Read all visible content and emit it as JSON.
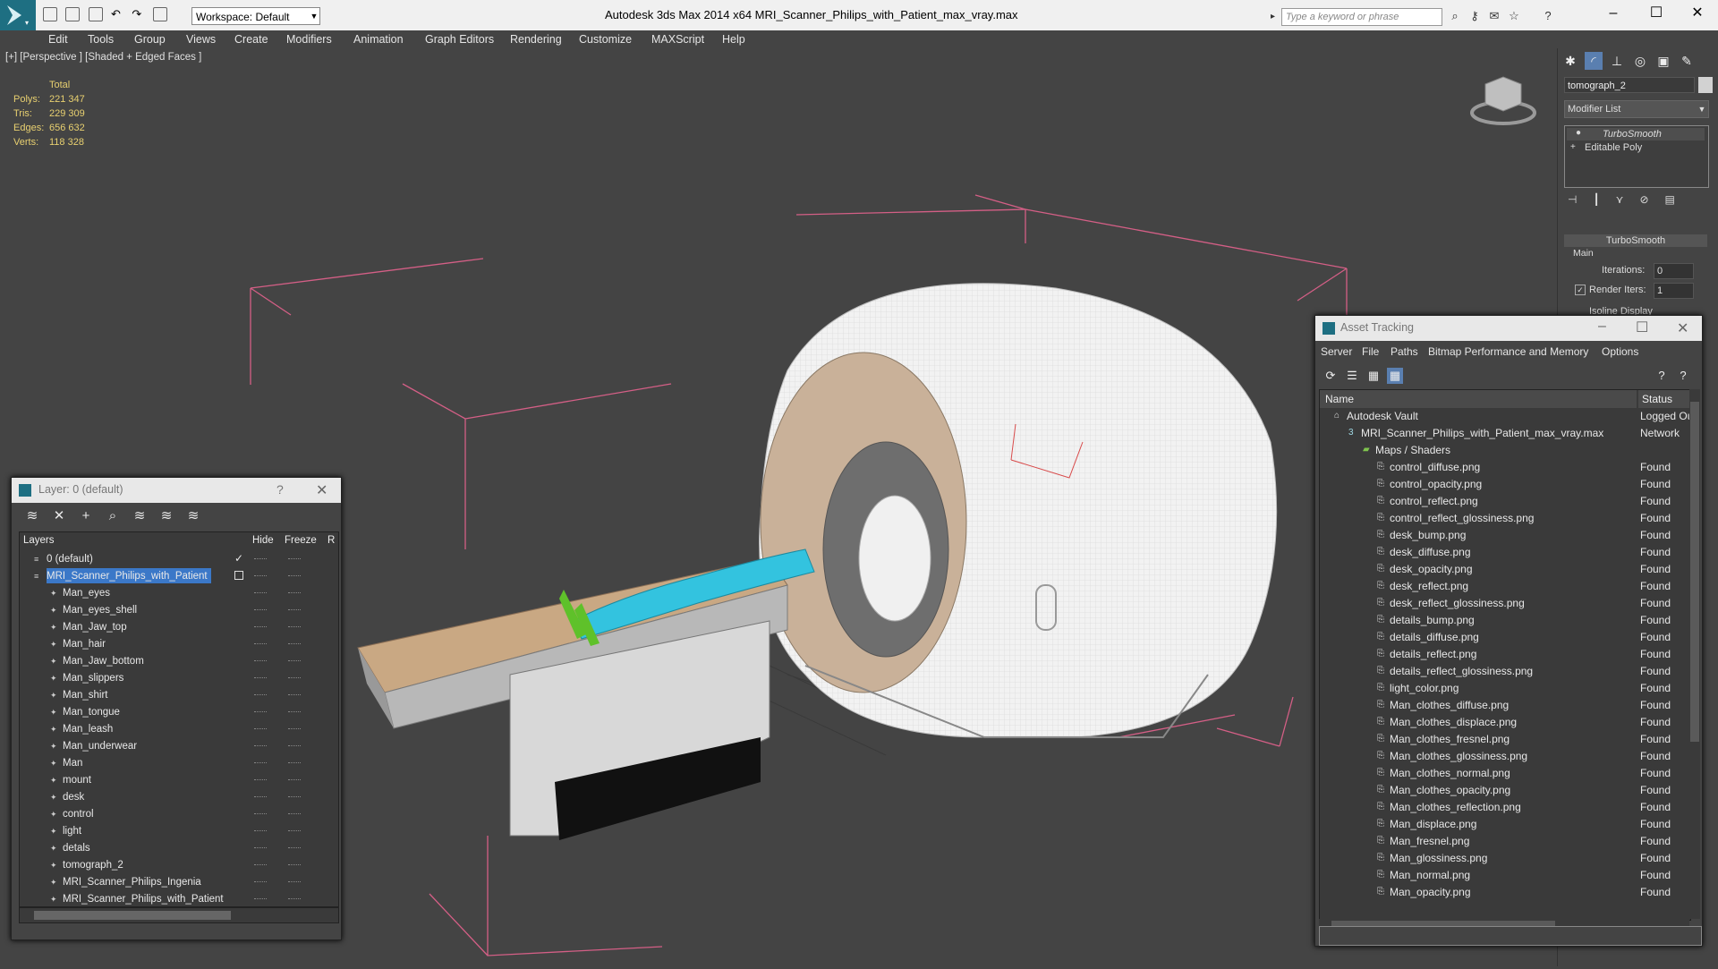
{
  "window": {
    "title": "Autodesk 3ds Max  2014 x64       MRI_Scanner_Philips_with_Patient_max_vray.max",
    "workspace": "Workspace: Default",
    "search_placeholder": "Type a keyword or phrase"
  },
  "menu": [
    "Edit",
    "Tools",
    "Group",
    "Views",
    "Create",
    "Modifiers",
    "Animation",
    "Graph Editors",
    "Rendering",
    "Customize",
    "MAXScript",
    "Help"
  ],
  "viewport": {
    "label": "[+] [Perspective ] [Shaded + Edged Faces ]",
    "stats_header": "Total",
    "stats": [
      {
        "label": "Polys:",
        "value": "221 347"
      },
      {
        "label": "Tris:",
        "value": "229 309"
      },
      {
        "label": "Edges:",
        "value": "656 632"
      },
      {
        "label": "Verts:",
        "value": "118 328"
      }
    ],
    "colors": {
      "box": "#d45f86",
      "wire": "#ffffff",
      "scanner": "#f4f4f4",
      "patient": "#33c3df",
      "slippers": "#5fc12a",
      "bore": "#b9a084"
    }
  },
  "command_panel": {
    "object_name": "tomograph_2",
    "modifier_list": "Modifier List",
    "stack": [
      "TurboSmooth",
      "Editable Poly"
    ],
    "rollout_title": "TurboSmooth",
    "group": "Main",
    "iterations_label": "Iterations:",
    "iterations_value": "0",
    "render_iters_label": "Render Iters:",
    "render_iters_value": "1",
    "isoline_label": "Isoline Display"
  },
  "layer_dialog": {
    "title": "Layer: 0 (default)",
    "help": "?",
    "columns": [
      "Layers",
      "Hide",
      "Freeze",
      "R"
    ],
    "rows": [
      {
        "name": "0 (default)",
        "level": 0,
        "checked": true
      },
      {
        "name": "MRI_Scanner_Philips_with_Patient",
        "level": 0,
        "selected": true
      },
      {
        "name": "Man_eyes",
        "level": 1
      },
      {
        "name": "Man_eyes_shell",
        "level": 1
      },
      {
        "name": "Man_Jaw_top",
        "level": 1
      },
      {
        "name": "Man_hair",
        "level": 1
      },
      {
        "name": "Man_Jaw_bottom",
        "level": 1
      },
      {
        "name": "Man_slippers",
        "level": 1
      },
      {
        "name": "Man_shirt",
        "level": 1
      },
      {
        "name": "Man_tongue",
        "level": 1
      },
      {
        "name": "Man_leash",
        "level": 1
      },
      {
        "name": "Man_underwear",
        "level": 1
      },
      {
        "name": "Man",
        "level": 1
      },
      {
        "name": "mount",
        "level": 1
      },
      {
        "name": "desk",
        "level": 1
      },
      {
        "name": "control",
        "level": 1
      },
      {
        "name": "light",
        "level": 1
      },
      {
        "name": "detals",
        "level": 1
      },
      {
        "name": "tomograph_2",
        "level": 1
      },
      {
        "name": "MRI_Scanner_Philips_Ingenia",
        "level": 1
      },
      {
        "name": "MRI_Scanner_Philips_with_Patient",
        "level": 1
      }
    ]
  },
  "asset_tracking": {
    "title": "Asset Tracking",
    "menu": [
      "Server",
      "File",
      "Paths",
      "Bitmap Performance and Memory",
      "Options"
    ],
    "columns": [
      "Name",
      "Status"
    ],
    "rows": [
      {
        "name": "Autodesk Vault",
        "status": "Logged Out",
        "level": 1,
        "icon": "vault"
      },
      {
        "name": "MRI_Scanner_Philips_with_Patient_max_vray.max",
        "status": "Network",
        "level": 2,
        "icon": "max"
      },
      {
        "name": "Maps / Shaders",
        "status": "",
        "level": 3,
        "icon": "folder"
      },
      {
        "name": "control_diffuse.png",
        "status": "Found",
        "level": 4
      },
      {
        "name": "control_opacity.png",
        "status": "Found",
        "level": 4
      },
      {
        "name": "control_reflect.png",
        "status": "Found",
        "level": 4
      },
      {
        "name": "control_reflect_glossiness.png",
        "status": "Found",
        "level": 4
      },
      {
        "name": "desk_bump.png",
        "status": "Found",
        "level": 4
      },
      {
        "name": "desk_diffuse.png",
        "status": "Found",
        "level": 4
      },
      {
        "name": "desk_opacity.png",
        "status": "Found",
        "level": 4
      },
      {
        "name": "desk_reflect.png",
        "status": "Found",
        "level": 4
      },
      {
        "name": "desk_reflect_glossiness.png",
        "status": "Found",
        "level": 4
      },
      {
        "name": "details_bump.png",
        "status": "Found",
        "level": 4
      },
      {
        "name": "details_diffuse.png",
        "status": "Found",
        "level": 4
      },
      {
        "name": "details_reflect.png",
        "status": "Found",
        "level": 4
      },
      {
        "name": "details_reflect_glossiness.png",
        "status": "Found",
        "level": 4
      },
      {
        "name": "light_color.png",
        "status": "Found",
        "level": 4
      },
      {
        "name": "Man_clothes_diffuse.png",
        "status": "Found",
        "level": 4
      },
      {
        "name": "Man_clothes_displace.png",
        "status": "Found",
        "level": 4
      },
      {
        "name": "Man_clothes_fresnel.png",
        "status": "Found",
        "level": 4
      },
      {
        "name": "Man_clothes_glossiness.png",
        "status": "Found",
        "level": 4
      },
      {
        "name": "Man_clothes_normal.png",
        "status": "Found",
        "level": 4
      },
      {
        "name": "Man_clothes_opacity.png",
        "status": "Found",
        "level": 4
      },
      {
        "name": "Man_clothes_reflection.png",
        "status": "Found",
        "level": 4
      },
      {
        "name": "Man_displace.png",
        "status": "Found",
        "level": 4
      },
      {
        "name": "Man_fresnel.png",
        "status": "Found",
        "level": 4
      },
      {
        "name": "Man_glossiness.png",
        "status": "Found",
        "level": 4
      },
      {
        "name": "Man_normal.png",
        "status": "Found",
        "level": 4
      },
      {
        "name": "Man_opacity.png",
        "status": "Found",
        "level": 4
      }
    ]
  }
}
